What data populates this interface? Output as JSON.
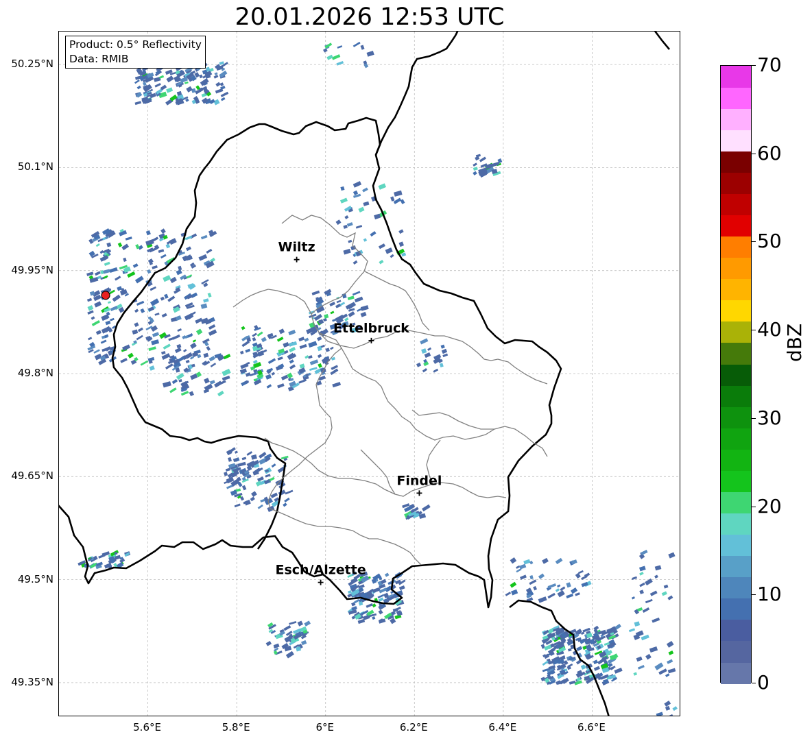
{
  "title": "20.01.2026 12:53 UTC",
  "info_box": {
    "product": "Product: 0.5° Reflectivity",
    "data": "Data: RMIB"
  },
  "lat_ticks": [
    "50.25°N",
    "50.1°N",
    "49.95°N",
    "49.8°N",
    "49.65°N",
    "49.5°N",
    "49.35°N"
  ],
  "lon_ticks": [
    "5.6°E",
    "5.8°E",
    "6°E",
    "6.2°E",
    "6.4°E",
    "6.6°E"
  ],
  "cities": [
    {
      "name": "Wiltz",
      "lon": 5.935,
      "lat": 49.966
    },
    {
      "name": "Ettelbruck",
      "lon": 6.103,
      "lat": 49.848
    },
    {
      "name": "Findel",
      "lon": 6.211,
      "lat": 49.626
    },
    {
      "name": "Esch/Alzette",
      "lon": 5.989,
      "lat": 49.496
    }
  ],
  "radar_site": {
    "name": "radar-site",
    "lon": 5.505,
    "lat": 49.914,
    "color": "#e82020"
  },
  "colorbar": {
    "label": "dBZ",
    "ticks": [
      "0",
      "10",
      "20",
      "30",
      "40",
      "50",
      "60",
      "70"
    ],
    "colors": [
      "#6677aa",
      "#5566a0",
      "#4a5da0",
      "#4470b0",
      "#4e86bb",
      "#58a0c8",
      "#62c0d8",
      "#5fd6c0",
      "#3ed672",
      "#14c41c",
      "#12b412",
      "#10a410",
      "#0e920e",
      "#0a7c0a",
      "#075c07",
      "#457a0a",
      "#aab207",
      "#ffd700",
      "#ffb400",
      "#ff9a00",
      "#ff7e00",
      "#e10000",
      "#c00000",
      "#9c0000",
      "#7a0000",
      "#ffe0ff",
      "#ffb0ff",
      "#ff66ff",
      "#e838e8"
    ]
  }
}
